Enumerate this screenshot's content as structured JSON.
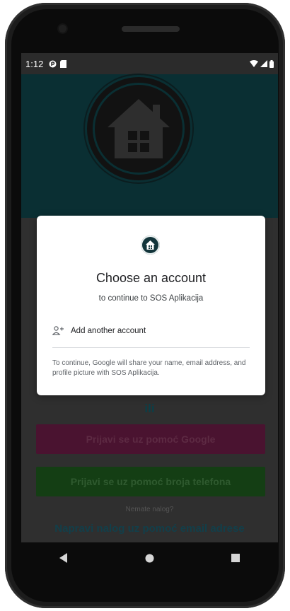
{
  "status_bar": {
    "time": "1:12"
  },
  "dialog": {
    "title": "Choose an account",
    "subtitle": "to continue to SOS Aplikacija",
    "add_account_label": "Add another account",
    "disclaimer": "To continue, Google will share your name, email address, and profile picture with SOS Aplikacija."
  },
  "background": {
    "or_label": "ili",
    "google_button": "Prijavi se uz pomoć Google",
    "phone_button": "Prijavi se uz pomoć broja telefona",
    "no_account_text": "Nemate nalog?",
    "email_signup_link": "Napravi nalog uz pomoć email adrese"
  },
  "icons": [
    "wifi-icon",
    "signal-icon",
    "battery-icon",
    "back-icon",
    "home-icon",
    "recents-icon",
    "add-account-icon",
    "house-logo-icon"
  ],
  "colors": {
    "hero_bg": "#0a2f33",
    "google_button_bg": "#4a1330",
    "phone_button_bg": "#143e14",
    "link_color": "#123f4a"
  }
}
